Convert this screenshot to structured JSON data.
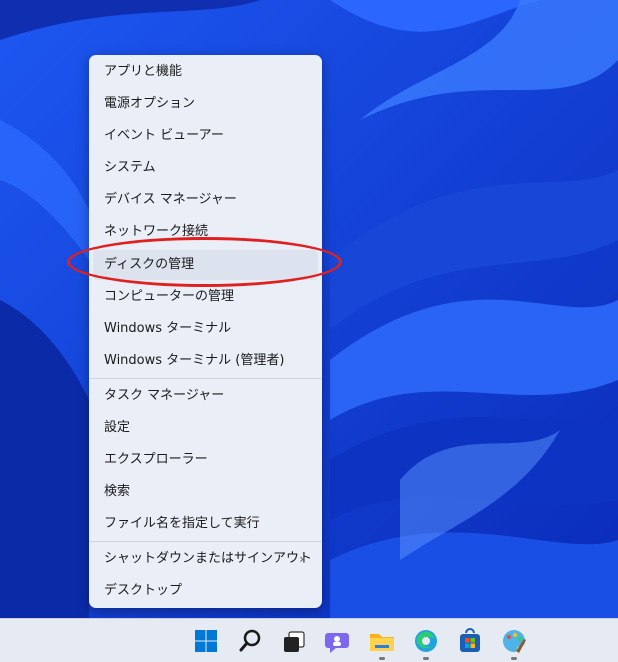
{
  "menu": {
    "items": [
      {
        "label": "アプリと機能"
      },
      {
        "label": "電源オプション"
      },
      {
        "label": "イベント ビューアー"
      },
      {
        "label": "システム"
      },
      {
        "label": "デバイス マネージャー"
      },
      {
        "label": "ネットワーク接続"
      },
      {
        "label": "ディスクの管理"
      },
      {
        "label": "コンピューターの管理"
      },
      {
        "label": "Windows ターミナル"
      },
      {
        "label": "Windows ターミナル (管理者)"
      },
      {
        "label": "タスク マネージャー"
      },
      {
        "label": "設定"
      },
      {
        "label": "エクスプローラー"
      },
      {
        "label": "検索"
      },
      {
        "label": "ファイル名を指定して実行"
      },
      {
        "label": "シャットダウンまたはサインアウト",
        "chevron": "›"
      },
      {
        "label": "デスクトップ"
      }
    ],
    "highlighted": "ディスクの管理"
  },
  "taskbar": {
    "icons": [
      "windows-start-icon",
      "search-icon",
      "task-view-icon",
      "chat-icon",
      "file-explorer-icon",
      "edge-icon",
      "store-icon",
      "paint-icon"
    ],
    "running": [
      "file-explorer-icon",
      "edge-icon",
      "paint-icon"
    ]
  },
  "colors": {
    "menu_bg": "#e9eef7",
    "annotation": "#e0201e",
    "accent": "#0067c0",
    "wallpaper": "#1b3fd0"
  }
}
